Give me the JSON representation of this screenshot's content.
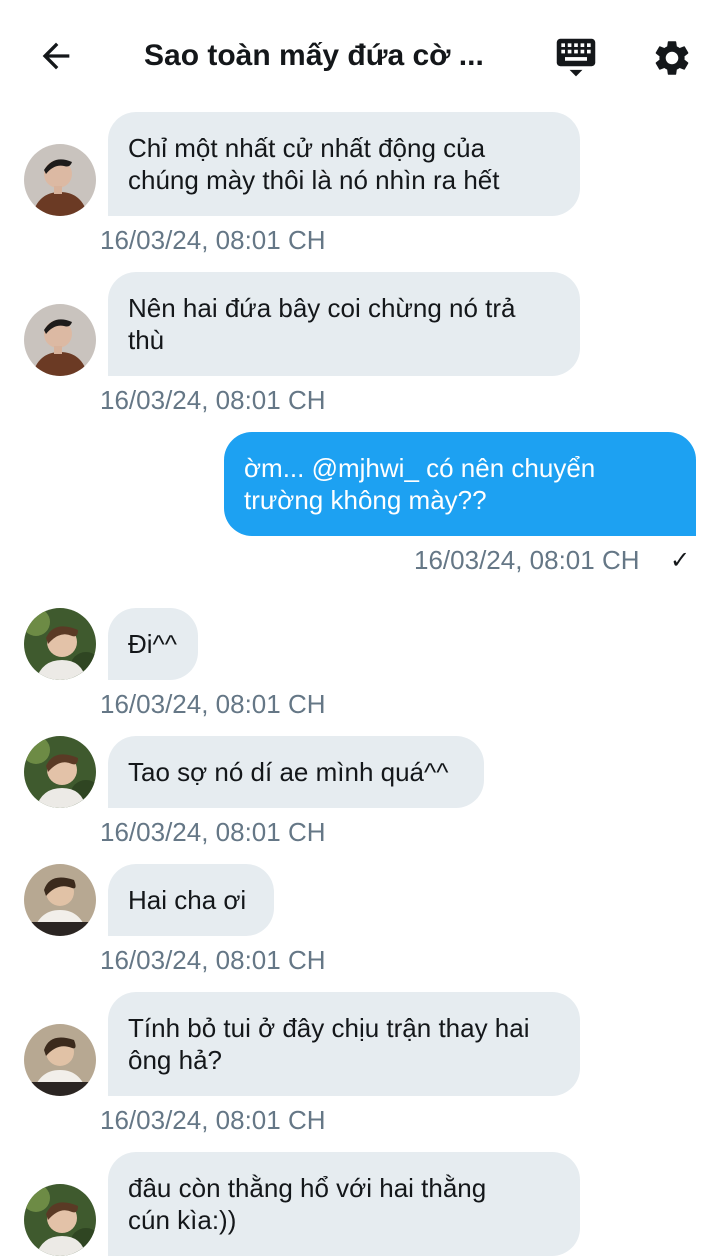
{
  "header": {
    "title": "Sao toàn mấy đứa cờ ...",
    "back_icon": "arrow-left-icon",
    "keyboard_icon": "keyboard-icon",
    "settings_icon": "gear-icon"
  },
  "colors": {
    "incoming_bubble": "#e6ecf0",
    "outgoing_bubble": "#1da1f2",
    "timestamp": "#657786"
  },
  "messages": [
    {
      "direction": "in",
      "text": "Chỉ một nhất cử nhất động của\nchúng mày thôi là nó nhìn ra hết",
      "time": "16/03/24, 08:01 CH"
    },
    {
      "direction": "in",
      "text": "Nên hai đứa bây coi chừng nó trả\nthù",
      "time": "16/03/24, 08:01 CH"
    },
    {
      "direction": "out",
      "text": "ờm... @mjhwi_ có nên chuyển\ntrường không mày??",
      "time": "16/03/24, 08:01 CH",
      "status": "✓"
    },
    {
      "direction": "in",
      "text": "Đi^^",
      "time": "16/03/24, 08:01 CH"
    },
    {
      "direction": "in",
      "text": "Tao sợ nó dí ae mình quá^^",
      "time": "16/03/24, 08:01 CH"
    },
    {
      "direction": "in",
      "text": "Hai cha ơi",
      "time": "16/03/24, 08:01 CH"
    },
    {
      "direction": "in",
      "text": "Tính bỏ tui ở đây chịu trận thay hai\nông hả?",
      "time": "16/03/24, 08:01 CH"
    },
    {
      "direction": "in",
      "text": "đâu còn thằng hổ với hai thằng\ncún kìa:))",
      "time": ""
    }
  ]
}
